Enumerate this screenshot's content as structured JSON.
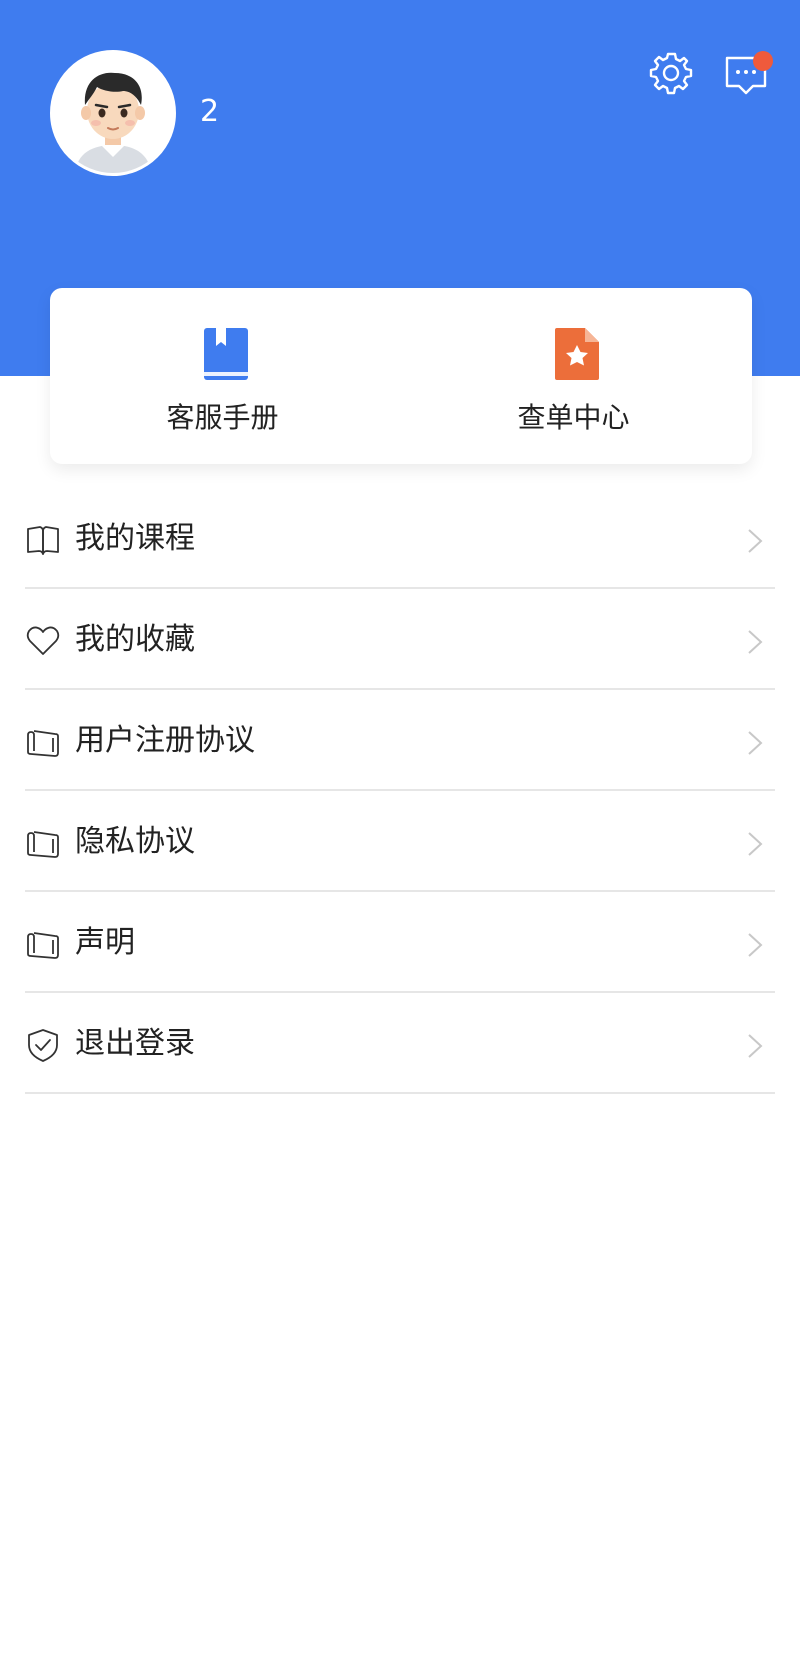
{
  "profile": {
    "username": "2",
    "avatar_icon": "user-avatar"
  },
  "header": {
    "settings_icon": "gear-icon",
    "messages_icon": "message-icon",
    "has_notification": true
  },
  "quick_actions": [
    {
      "label": "客服手册",
      "icon": "book-icon",
      "color": "#3f7cef"
    },
    {
      "label": "查单中心",
      "icon": "star-document-icon",
      "color": "#ec6e3a"
    }
  ],
  "menu": [
    {
      "label": "我的课程",
      "icon": "open-book-icon"
    },
    {
      "label": "我的收藏",
      "icon": "heart-icon"
    },
    {
      "label": "用户注册协议",
      "icon": "scroll-icon"
    },
    {
      "label": "隐私协议",
      "icon": "scroll-icon"
    },
    {
      "label": "声明",
      "icon": "scroll-icon"
    },
    {
      "label": "退出登录",
      "icon": "shield-check-icon"
    }
  ],
  "colors": {
    "header": "#3f7cef",
    "notification": "#ef5a3c"
  }
}
